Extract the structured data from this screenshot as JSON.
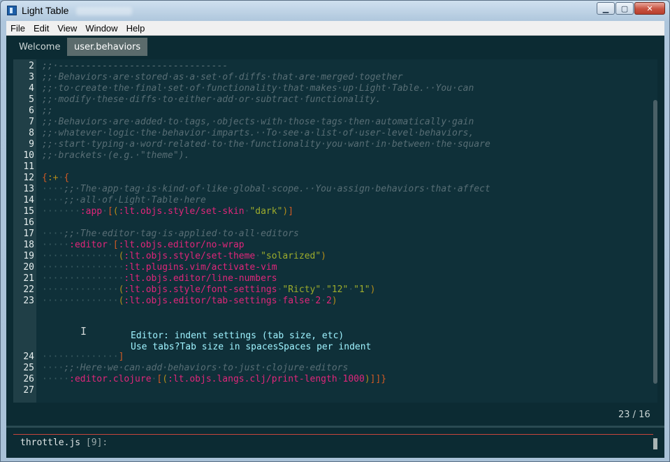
{
  "window": {
    "title": "Light Table",
    "buttons": {
      "minimize": "▁",
      "maximize": "▢",
      "close": "✕"
    }
  },
  "menu": [
    "File",
    "Edit",
    "View",
    "Window",
    "Help"
  ],
  "tabs": [
    {
      "label": "Welcome",
      "active": false
    },
    {
      "label": "user.behaviors",
      "active": true
    }
  ],
  "editor": {
    "line_numbers": [
      "2",
      "3",
      "4",
      "5",
      "6",
      "7",
      "8",
      "9",
      "10",
      "11",
      "12",
      "13",
      "14",
      "15",
      "16",
      "17",
      "18",
      "19",
      "20",
      "21",
      "22",
      "23",
      "24",
      "25",
      "26",
      "27"
    ],
    "lines": [
      [
        [
          "cm",
          ";;·-------------------------------"
        ]
      ],
      [
        [
          "cm",
          ";;·Behaviors·are·stored·as·a·set·of·diffs·that·are·merged·together"
        ]
      ],
      [
        [
          "cm",
          ";;·to·create·the·final·set·of·functionality·that·makes·up·Light·Table.··You·can"
        ]
      ],
      [
        [
          "cm",
          ";;·modify·these·diffs·to·either·add·or·subtract·functionality."
        ]
      ],
      [
        [
          "cm",
          ";;"
        ]
      ],
      [
        [
          "cm",
          ";;·Behaviors·are·added·to·tags,·objects·with·those·tags·then·automatically·gain"
        ]
      ],
      [
        [
          "cm",
          ";;·whatever·logic·the·behavior·imparts.··To·see·a·list·of·user-level·behaviors,"
        ]
      ],
      [
        [
          "cm",
          ";;·start·typing·a·word·related·to·the·functionality·you·want·in·between·the·square"
        ]
      ],
      [
        [
          "cm",
          ";;·brackets·(e.g.·\"theme\")."
        ]
      ],
      [],
      [
        [
          "br",
          "{"
        ],
        [
          "pn",
          ":+"
        ],
        [
          "ws",
          "·"
        ],
        [
          "br",
          "{"
        ]
      ],
      [
        [
          "ws",
          "····"
        ],
        [
          "cm",
          ";;·The·app·tag·is·kind·of·like·global·scope.··You·assign·behaviors·that·affect"
        ]
      ],
      [
        [
          "ws",
          "····"
        ],
        [
          "cm",
          ";;·all·of·Light·Table·here"
        ]
      ],
      [
        [
          "ws",
          "·······"
        ],
        [
          "kw",
          ":app"
        ],
        [
          "ws",
          "·"
        ],
        [
          "br",
          "["
        ],
        [
          "pn",
          "("
        ],
        [
          "tx",
          ":lt.objs.style/set-skin"
        ],
        [
          "ws",
          "·"
        ],
        [
          "str",
          "\"dark\""
        ],
        [
          "pn",
          ")"
        ],
        [
          "br",
          "]"
        ]
      ],
      [],
      [
        [
          "ws",
          "····"
        ],
        [
          "cm",
          ";;·The·editor·tag·is·applied·to·all·editors"
        ]
      ],
      [
        [
          "ws",
          "·····"
        ],
        [
          "kw",
          ":editor"
        ],
        [
          "ws",
          "·"
        ],
        [
          "br",
          "["
        ],
        [
          "tx",
          ":lt.objs.editor/no-wrap"
        ]
      ],
      [
        [
          "ws",
          "··············"
        ],
        [
          "pn",
          "("
        ],
        [
          "tx",
          ":lt.objs.style/set-theme"
        ],
        [
          "ws",
          "·"
        ],
        [
          "str",
          "\"solarized\""
        ],
        [
          "pn",
          ")"
        ]
      ],
      [
        [
          "ws",
          "···············"
        ],
        [
          "tx",
          ":lt.plugins.vim/activate-vim"
        ]
      ],
      [
        [
          "ws",
          "···············"
        ],
        [
          "tx",
          ":lt.objs.editor/line-numbers"
        ]
      ],
      [
        [
          "ws",
          "··············"
        ],
        [
          "pn",
          "("
        ],
        [
          "tx",
          ":lt.objs.style/font-settings"
        ],
        [
          "ws",
          "·"
        ],
        [
          "str",
          "\"Ricty\""
        ],
        [
          "ws",
          "·"
        ],
        [
          "str",
          "\"12\""
        ],
        [
          "ws",
          "·"
        ],
        [
          "str",
          "\"1\""
        ],
        [
          "pn",
          ")"
        ]
      ],
      [
        [
          "ws",
          "··············"
        ],
        [
          "pn",
          "("
        ],
        [
          "tx",
          ":lt.objs.editor/tab-settings"
        ],
        [
          "ws",
          "·"
        ],
        [
          "tx",
          "false"
        ],
        [
          "ws",
          "·"
        ],
        [
          "tx",
          "2"
        ],
        [
          "ws",
          "·"
        ],
        [
          "tx",
          "2"
        ],
        [
          "pn",
          ")"
        ]
      ],
      [
        [
          "ws",
          "··············"
        ],
        [
          "br",
          "]"
        ]
      ],
      [
        [
          "ws",
          "····"
        ],
        [
          "cm",
          ";;·Here·we·can·add·behaviors·to·just·clojure·editors"
        ]
      ],
      [
        [
          "ws",
          "·····"
        ],
        [
          "kw",
          ":editor.clojure"
        ],
        [
          "ws",
          "·"
        ],
        [
          "br",
          "["
        ],
        [
          "pn",
          "("
        ],
        [
          "tx",
          ":lt.objs.langs.clj/print-length"
        ],
        [
          "ws",
          "·"
        ],
        [
          "tx",
          "1000"
        ],
        [
          "pn",
          ")"
        ],
        [
          "br",
          "]]"
        ],
        [
          "br",
          "}"
        ]
      ],
      []
    ],
    "inline_widget": {
      "line1": "Editor: indent settings (tab size, etc)",
      "line2": "Use tabs?Tab size in spacesSpaces per indent"
    },
    "cursor_position": "23 / 16"
  },
  "console": {
    "file": "throttle.js",
    "count": "[9]:"
  }
}
